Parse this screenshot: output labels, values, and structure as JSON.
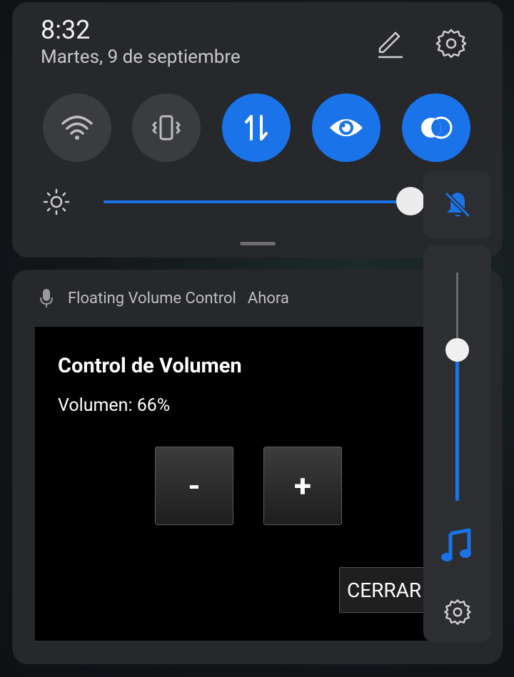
{
  "status": {
    "time": "8:32",
    "date": "Martes, 9 de septiembre"
  },
  "header_icons": [
    "pencil-icon",
    "gear-icon"
  ],
  "quick_tiles": [
    {
      "icon": "wifi-icon",
      "state": "off"
    },
    {
      "icon": "vibrate-icon",
      "state": "off"
    },
    {
      "icon": "mobile-data-icon",
      "state": "on"
    },
    {
      "icon": "eye-comfort-icon",
      "state": "on"
    },
    {
      "icon": "color-inversion-icon",
      "state": "on"
    }
  ],
  "brightness": {
    "icon": "sun-icon",
    "level": 1.0
  },
  "notification": {
    "app_icon": "microphone-icon",
    "app_name": "Floating Volume Control",
    "time": "Ahora",
    "title": "Control de Volumen",
    "volume_text": "Volumen: 66%",
    "minus_label": "-",
    "plus_label": "+",
    "close_label": "CERRAR"
  },
  "volume_popup": {
    "mute_icon": "bell-off-icon",
    "level": 0.66,
    "stream_icon": "music-note-icon",
    "settings_icon": "gear-icon"
  },
  "colors": {
    "accent": "#1a73e8",
    "panel": "#26282b",
    "tile_off": "#3a3c3f"
  }
}
